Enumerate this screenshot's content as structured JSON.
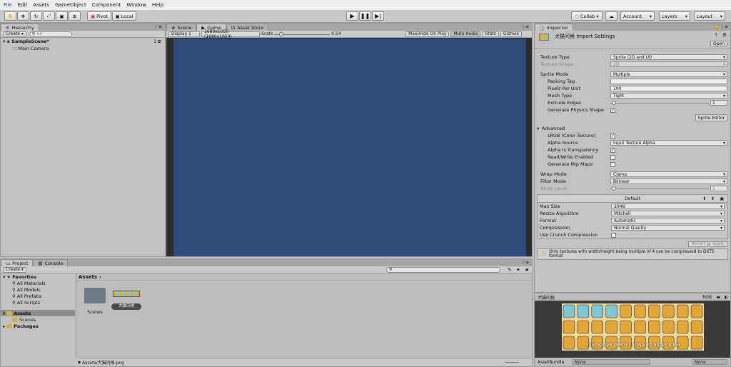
{
  "menu": {
    "items": [
      "File",
      "Edit",
      "Assets",
      "GameObject",
      "Component",
      "Window",
      "Help"
    ]
  },
  "toolbar": {
    "pivot_label": "Pivot",
    "local_label": "Local",
    "collab_label": "Collab ▾",
    "account_label": "Account",
    "layers_label": "Layers",
    "layout_label": "Layout"
  },
  "hierarchy": {
    "tab_label": "Hierarchy",
    "create_label": "Create ▾",
    "search_placeholder": "All",
    "scene_name": "SampleScene*",
    "items": [
      "Main Camera"
    ]
  },
  "game": {
    "tabs": [
      "Scene",
      "Game",
      "Asset Store"
    ],
    "display_label": "Display 1",
    "resolution_label": "1680x1050 (1680x1050)",
    "scale_label": "Scale",
    "scale_value": "0.54",
    "scale_fraction": 0.1,
    "maximize_label": "Maximize On Play",
    "mute_label": "Mute Audio",
    "stats_label": "Stats",
    "gizmos_label": "Gizmos",
    "background": "#2e4b7b"
  },
  "inspector": {
    "tab_label": "Inspector",
    "title": "犬猫问候 Import Settings",
    "open_label": "Open",
    "texture_type_label": "Texture Type",
    "texture_type_value": "Sprite (2D and UI)",
    "texture_shape_label": "Texture Shape",
    "texture_shape_value": "2D",
    "sprite_mode_label": "Sprite Mode",
    "sprite_mode_value": "Multiple",
    "packing_tag_label": "Packing Tag",
    "packing_tag_value": "",
    "ppu_label": "Pixels Per Unit",
    "ppu_value": "100",
    "mesh_type_label": "Mesh Type",
    "mesh_type_value": "Tight",
    "extrude_label": "Extrude Edges",
    "extrude_value": "1",
    "gen_physics_label": "Generate Physics Shape",
    "sprite_editor_label": "Sprite Editor",
    "advanced_label": "Advanced",
    "srgb_label": "sRGB (Color Texture)",
    "alpha_source_label": "Alpha Source",
    "alpha_source_value": "Input Texture Alpha",
    "alpha_transp_label": "Alpha Is Transparency",
    "readwrite_label": "Read/Write Enabled",
    "mipmaps_label": "Generate Mip Maps",
    "wrap_label": "Wrap Mode",
    "wrap_value": "Clamp",
    "filter_label": "Filter Mode",
    "filter_value": "Bilinear",
    "aniso_label": "Aniso Level",
    "aniso_value": "1",
    "platform_label": "Default",
    "max_size_label": "Max Size",
    "max_size_value": "2048",
    "resize_label": "Resize Algorithm",
    "resize_value": "Mitchell",
    "format_label": "Format",
    "format_value": "Automatic",
    "compression_label": "Compression",
    "compression_value": "Normal Quality",
    "crunch_label": "Use Crunch Compression",
    "revert_label": "Revert",
    "apply_label": "Apply",
    "warning_text": "Only textures with width/height being multiple of 4 can be compressed to DXT5 format"
  },
  "preview": {
    "title": "犬猫问候",
    "rgb_label": "RGB",
    "info_text": "3452x2023 (NPOT)  RGBA  32 bit  17.8 MB",
    "assetbundle_label": "AssetBundle",
    "bundle_value": "None",
    "variant_value": "None"
  },
  "project": {
    "tabs": [
      "Project",
      "Console"
    ],
    "create_label": "Create ▾",
    "favorites_label": "Favorites",
    "favorites": [
      "All Materials",
      "All Models",
      "All Prefabs",
      "All Scripts"
    ],
    "assets_label": "Assets",
    "asset_children": [
      "Scenes"
    ],
    "packages_label": "Packages",
    "breadcrumb": "Assets",
    "breadcrumb_arrow": "›",
    "grid_items": [
      "Scenes",
      "犬猫问候"
    ],
    "status_path": "Assets/犬猫问候.png"
  }
}
